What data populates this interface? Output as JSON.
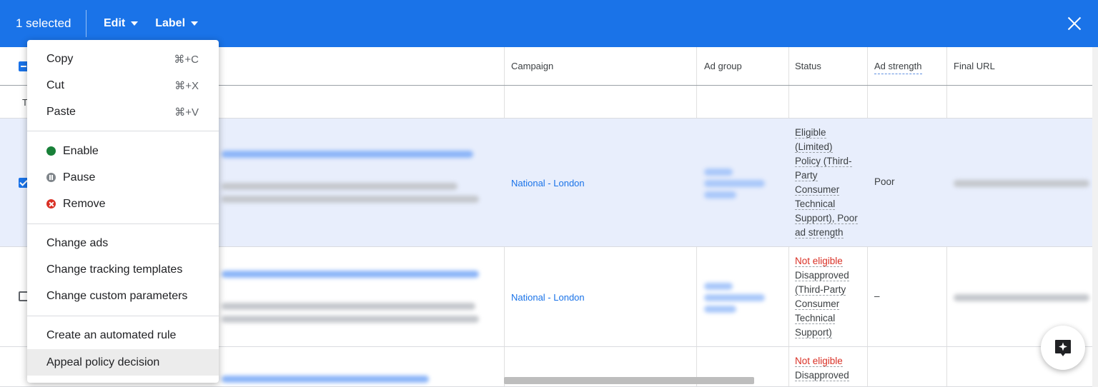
{
  "topbar": {
    "selected_text": "1 selected",
    "edit_label": "Edit",
    "label_label": "Label"
  },
  "menu": {
    "copy": {
      "label": "Copy",
      "shortcut": "⌘+C"
    },
    "cut": {
      "label": "Cut",
      "shortcut": "⌘+X"
    },
    "paste": {
      "label": "Paste",
      "shortcut": "⌘+V"
    },
    "enable": "Enable",
    "pause": "Pause",
    "remove": "Remove",
    "change_ads": "Change ads",
    "change_tracking": "Change tracking templates",
    "change_custom": "Change custom parameters",
    "create_rule": "Create an automated rule",
    "appeal": "Appeal policy decision"
  },
  "table": {
    "columns": {
      "campaign": "Campaign",
      "ad_group": "Ad group",
      "status": "Status",
      "ad_strength": "Ad strength",
      "final_url": "Final URL"
    },
    "total_row_fragment": "T",
    "rows": [
      {
        "campaign": "National - London",
        "status_lines": [
          "Eligible",
          "(Limited)",
          "Policy (Third-",
          "Party",
          "Consumer",
          "Technical",
          "Support), Poor",
          "ad strength"
        ],
        "ad_strength": "Poor"
      },
      {
        "campaign": "National - London",
        "status_red": "Not eligible",
        "status_lines": [
          "Disapproved",
          "(Third-Party",
          "Consumer",
          "Technical",
          "Support)"
        ],
        "ad_strength": "–"
      },
      {
        "status_red": "Not eligible",
        "status_lines": [
          "Disapproved"
        ]
      }
    ]
  },
  "colors": {
    "accent": "#1a73e8",
    "red": "#d93025",
    "green": "#188038"
  }
}
